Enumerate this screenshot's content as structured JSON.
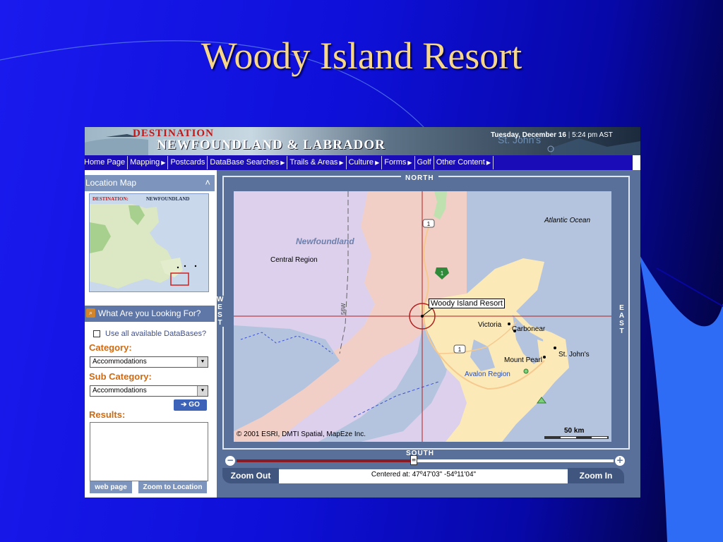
{
  "slide": {
    "title": "Woody Island Resort"
  },
  "colors": {
    "title": "#f6d68a",
    "nav_bg": "#1a0db8",
    "panel_head": "#7d95bd",
    "accent_orange": "#cf6a12",
    "map_land_nf": "#f2cfc6",
    "map_land_avalon": "#fbe9b8",
    "map_water": "#b4c4de",
    "marker_red": "#b02020"
  },
  "banner": {
    "brand_top": "DESTINATION",
    "brand_bottom": "NEWFOUNDLAND & LABRADOR",
    "date_bold": "Tuesday, December 16",
    "separator": "|",
    "time": "5:24 pm AST",
    "city_image_text": "St. John's"
  },
  "nav": {
    "items": [
      {
        "label": "Home Page",
        "arrow": ""
      },
      {
        "label": "Mapping",
        "arrow": "▶"
      },
      {
        "label": "Postcards",
        "arrow": ""
      },
      {
        "label": "DataBase Searches",
        "arrow": "▶"
      },
      {
        "label": "Trails & Areas",
        "arrow": "▶"
      },
      {
        "label": "Culture",
        "arrow": "▶"
      },
      {
        "label": "Forms",
        "arrow": "▶"
      },
      {
        "label": "Golf",
        "arrow": ""
      },
      {
        "label": "Other Content",
        "arrow": "▶"
      }
    ]
  },
  "left_panel": {
    "location_map": {
      "title": "Location Map",
      "collapse_icon": "chevron-up-icon",
      "inset_title_red": "DESTINATION:",
      "inset_title_dark": "NEWFOUNDLAND"
    },
    "search": {
      "title": "What Are you Looking For?",
      "icon": "search-icon",
      "use_all_label": "Use all available DataBases?",
      "use_all_checked": false,
      "category_label": "Category:",
      "category_value": "Accommodations",
      "subcategory_label": "Sub Category:",
      "subcategory_value": "Accommodations",
      "go_label": "GO",
      "go_arrow": "➔",
      "results_label": "Results:",
      "results_value": "",
      "web_page_label": "web page",
      "zoom_to_location_label": "Zoom to Location"
    }
  },
  "map": {
    "compass": {
      "north": "NORTH",
      "south": "SOUTH",
      "west": "WEST",
      "east": "EAST"
    },
    "labels": {
      "atlantic_ocean": "Atlantic Ocean",
      "newfoundland": "Newfoundland",
      "central_region": "Central Region",
      "avalon_region": "Avalon Region",
      "victoria": "Victoria",
      "carbonear": "Carbonear",
      "mount_pearl": "Mount Pearl",
      "st_johns": "St. John's",
      "route_1_a": "1",
      "route_1_b": "1",
      "route_1_c": "1",
      "gridline": "56W"
    },
    "poi_label": "Woody Island Resort",
    "copyright": "© 2001 ESRI, DMTI Spatial, MapEze Inc.",
    "scale_label": "50 km"
  },
  "zoom": {
    "zoom_out_label": "Zoom Out",
    "zoom_in_label": "Zoom In",
    "minus": "−",
    "plus": "+",
    "level_fraction": 0.47,
    "centered_text": "Centered at: 47º47'03\" -54º11'04\""
  }
}
